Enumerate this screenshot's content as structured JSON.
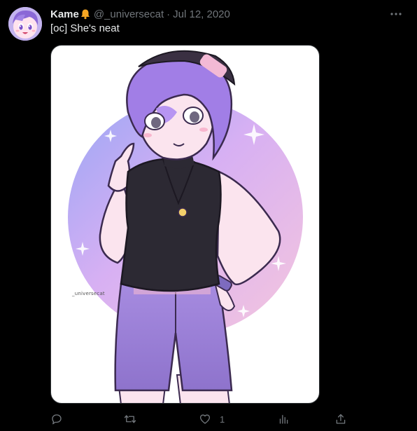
{
  "tweet": {
    "display_name": "Kame",
    "handle": "@_universecat",
    "separator": "·",
    "date": "Jul 12, 2020",
    "text": "[oc] She's neat",
    "media_alt": "",
    "watermark": "_universecat",
    "actions": {
      "reply_count": "",
      "retweet_count": "",
      "like_count": "1",
      "views_count": ""
    }
  },
  "colors": {
    "background": "#000000",
    "primary_text": "#e7e9ea",
    "secondary_text": "#71767b",
    "bell": "#f5a623"
  },
  "icons": {
    "bell": "bell-icon",
    "more": "more-horizontal-icon",
    "reply": "reply-icon",
    "retweet": "retweet-icon",
    "like": "heart-icon",
    "views": "bar-chart-icon",
    "share": "share-icon"
  }
}
